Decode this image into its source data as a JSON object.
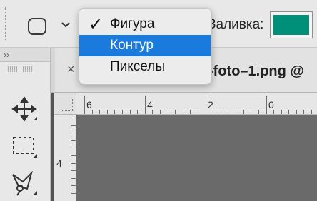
{
  "options_bar": {
    "tool_icon": "shape-square-icon",
    "mode_chevron_icon": "chevron-down-icon",
    "fill_label": "Заливка:",
    "fill_color": "#00907a"
  },
  "mode_menu": {
    "items": [
      {
        "label": "Фигура",
        "checked": true,
        "highlighted": false
      },
      {
        "label": "Контур",
        "checked": false,
        "highlighted": true
      },
      {
        "label": "Пикселы",
        "checked": false,
        "highlighted": false
      }
    ],
    "check_glyph": "✓",
    "highlight_color": "#1b7bdd"
  },
  "toolbar": {
    "collapse_label": "››",
    "tools": [
      {
        "name": "move-tool",
        "icon": "move-arrows-icon"
      },
      {
        "name": "marquee-tool",
        "icon": "rectangular-marquee-icon"
      },
      {
        "name": "lasso-tool",
        "icon": "polygonal-lasso-icon"
      }
    ]
  },
  "document": {
    "close_glyph": "×",
    "tab_title": "-foto–1.png @"
  },
  "rulers": {
    "top_labels": [
      "6",
      "4",
      "2",
      "0"
    ],
    "left_labels": [
      "4"
    ]
  }
}
